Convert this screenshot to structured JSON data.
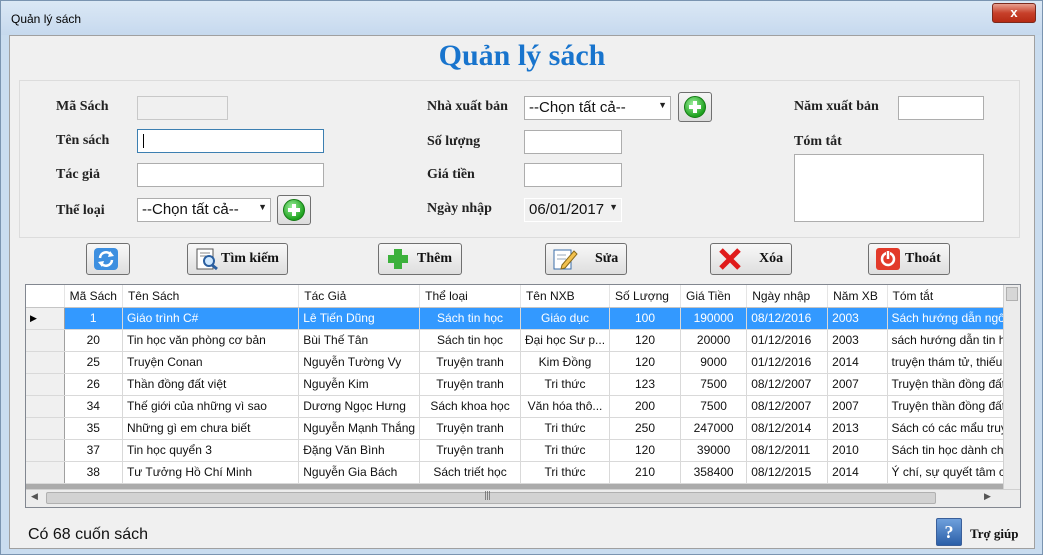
{
  "window": {
    "title": "Quản lý sách",
    "close_glyph": "x"
  },
  "app_title": "Quản lý sách",
  "form": {
    "ma_sach_label": "Mã Sách",
    "ma_sach_value": "",
    "ten_sach_label": "Tên sách",
    "ten_sach_value": "",
    "tac_gia_label": "Tác giả",
    "tac_gia_value": "",
    "the_loai_label": "Thể loại",
    "the_loai_selected": "--Chọn tất cả--",
    "nxb_label": "Nhà xuất bản",
    "nxb_selected": "--Chọn tất cả--",
    "so_luong_label": "Số lượng",
    "so_luong_value": "",
    "gia_tien_label": "Giá tiền",
    "gia_tien_value": "",
    "ngay_nhap_label": "Ngày nhập",
    "ngay_nhap_value": "06/01/2017",
    "nam_xb_label": "Năm xuất bản",
    "nam_xb_value": "",
    "tom_tat_label": "Tóm tắt",
    "tom_tat_value": ""
  },
  "toolbar": {
    "search_label": "Tìm kiếm",
    "add_label": "Thêm",
    "edit_label": "Sửa",
    "delete_label": "Xóa",
    "exit_label": "Thoát"
  },
  "grid": {
    "columns": [
      "Mã Sách",
      "Tên Sách",
      "Tác Giả",
      "Thể loại",
      "Tên NXB",
      "Số Lượng",
      "Giá Tiền",
      "Ngày nhập",
      "Năm XB",
      "Tóm tắt"
    ],
    "rows": [
      [
        "1",
        "Giáo trình C#",
        "Lê Tiến Dũng",
        "Sách tin học",
        "Giáo dục",
        "100",
        "190000",
        "08/12/2016",
        "2003",
        "Sách hướng dẫn ngôn"
      ],
      [
        "20",
        "Tin học văn phòng cơ bản",
        "Bùi Thế Tân",
        "Sách tin học",
        "Đại học Sư p...",
        "120",
        "20000",
        "01/12/2016",
        "2003",
        "sách hướng dẫn tin họ"
      ],
      [
        "25",
        "Truyện Conan",
        "Nguyễn Tường Vy",
        "Truyện tranh",
        "Kim Đồng",
        "120",
        "9000",
        "01/12/2016",
        "2014",
        "truyện thám tử, thiếu ni"
      ],
      [
        "26",
        "Thần đồng đất việt",
        "Nguyễn Kim",
        "Truyện tranh",
        "Tri thức",
        "123",
        "7500",
        "08/12/2007",
        "2007",
        "Truyện thần đồng đất"
      ],
      [
        "34",
        "Thế giới của những vì sao",
        "Dương Ngọc Hưng",
        "Sách khoa học",
        "Văn hóa thô...",
        "200",
        "7500",
        "08/12/2007",
        "2007",
        "Truyện thần đồng đất"
      ],
      [
        "35",
        "Những gì em chưa biết",
        "Nguyễn Mạnh Thắng",
        "Truyện tranh",
        "Tri thức",
        "250",
        "247000",
        "08/12/2014",
        "2013",
        "Sách có các mẩu truyệ"
      ],
      [
        "37",
        "Tin học quyển 3",
        "Đặng Văn Bình",
        "Truyện tranh",
        "Tri thức",
        "120",
        "39000",
        "08/12/2011",
        "2010",
        "Sách tin học dành cho"
      ],
      [
        "38",
        "Tư Tưởng Hồ Chí Minh",
        "Nguyễn Gia Bách",
        "Sách triết học",
        "Tri thức",
        "210",
        "358400",
        "08/12/2015",
        "2014",
        "Ý chí, sự quyết tâm củ"
      ]
    ]
  },
  "status_text": "Có 68 cuốn sách",
  "help_label": "Trợ giúp",
  "help_glyph": "?",
  "icons": [
    "refresh-icon",
    "search-icon",
    "plus-icon",
    "edit-icon",
    "delete-icon",
    "exit-icon",
    "help-icon"
  ]
}
